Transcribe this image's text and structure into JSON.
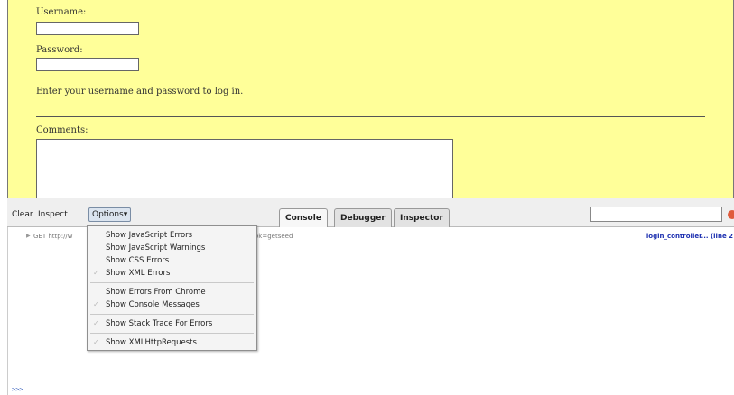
{
  "page": {
    "username_label": "Username:",
    "password_label": "Password:",
    "instructions": "Enter your username and password to log in.",
    "comments_label": "Comments:"
  },
  "toolbar": {
    "clear": "Clear",
    "inspect": "Inspect",
    "options": "Options▾",
    "tabs": [
      {
        "label": "Console",
        "active": true
      },
      {
        "label": "Debugger",
        "active": false
      },
      {
        "label": "Inspector",
        "active": false
      }
    ],
    "search_value": ""
  },
  "console": {
    "log": {
      "method": "GET http://w",
      "query_tail": "ok=getseed",
      "source": "login_controller... (line 2"
    },
    "prompt": ">>>"
  },
  "options_menu": {
    "items": [
      {
        "label": "Show JavaScript Errors",
        "checked": false
      },
      {
        "label": "Show JavaScript Warnings",
        "checked": false
      },
      {
        "label": "Show CSS Errors",
        "checked": false
      },
      {
        "label": "Show XML Errors",
        "checked": true
      },
      {
        "label": "Show Errors From Chrome",
        "checked": false
      },
      {
        "label": "Show Console Messages",
        "checked": true
      },
      {
        "label": "Show Stack Trace For Errors",
        "checked": true
      },
      {
        "label": "Show XMLHttpRequests",
        "checked": true
      }
    ]
  },
  "colors": {
    "page_background": "#ffff99",
    "link_blue": "#1c2fb0",
    "close_button": "#e05b3c"
  }
}
